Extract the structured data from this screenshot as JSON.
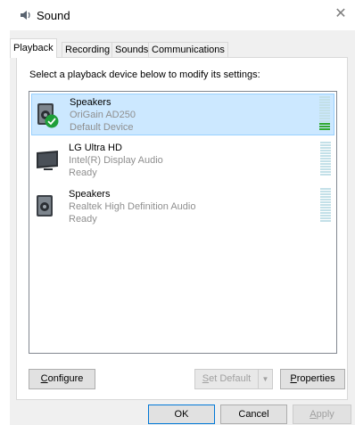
{
  "window": {
    "title": "Sound",
    "close_glyph": "✕",
    "title_icon": "speaker-icon"
  },
  "tabs": [
    {
      "label": "Playback",
      "active": true
    },
    {
      "label": "Recording",
      "active": false
    },
    {
      "label": "Sounds",
      "active": false
    },
    {
      "label": "Communications",
      "active": false
    }
  ],
  "playback": {
    "instruction": "Select a playback device below to modify its settings:",
    "devices": [
      {
        "name": "Speakers",
        "detail": "OriGain AD250",
        "status": "Default Device",
        "icon": "speaker-icon",
        "default": true,
        "selected": true,
        "level": 0.2
      },
      {
        "name": "LG Ultra HD",
        "detail": "Intel(R) Display Audio",
        "status": "Ready",
        "icon": "monitor-icon",
        "default": false,
        "selected": false,
        "level": 0
      },
      {
        "name": "Speakers",
        "detail": "Realtek High Definition Audio",
        "status": "Ready",
        "icon": "speaker-icon",
        "default": false,
        "selected": false,
        "level": 0
      }
    ],
    "buttons": {
      "configure": {
        "mnemonic": "C",
        "rest": "onfigure"
      },
      "set_default": {
        "mnemonic": "S",
        "rest": "et Default"
      },
      "properties": {
        "mnemonic": "P",
        "rest": "roperties"
      }
    }
  },
  "footer": {
    "ok": "OK",
    "cancel": "Cancel",
    "apply_mnemonic": "A",
    "apply_rest": "pply"
  },
  "colors": {
    "selection_bg": "#cce8ff",
    "selection_border": "#99d1ff",
    "meter_on": "#30a830",
    "default_check": "#1e9e3a"
  }
}
